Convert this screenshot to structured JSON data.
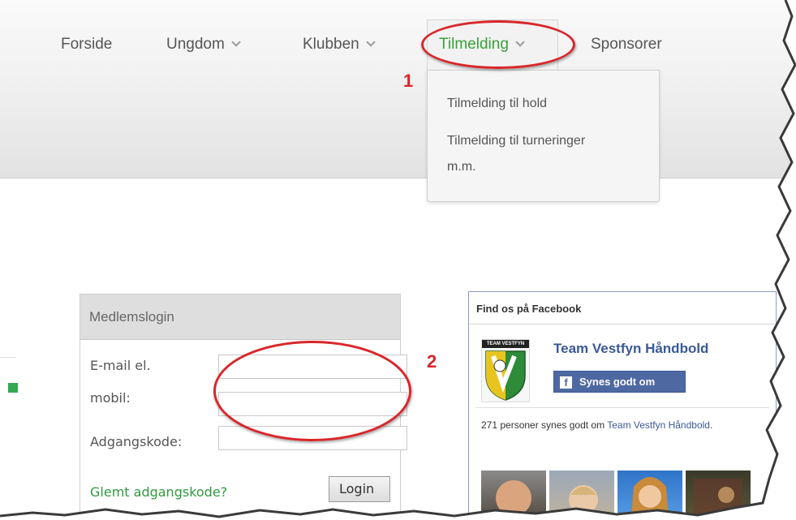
{
  "nav": {
    "items": [
      {
        "label": "Forside",
        "has_chevron": false,
        "active": false
      },
      {
        "label": "Ungdom",
        "has_chevron": true,
        "active": false
      },
      {
        "label": "Klubben",
        "has_chevron": true,
        "active": false
      },
      {
        "label": "Tilmelding",
        "has_chevron": true,
        "active": true
      },
      {
        "label": "Sponsorer",
        "has_chevron": false,
        "active": false
      }
    ],
    "dropdown": {
      "items": [
        {
          "label": "Tilmelding til hold"
        },
        {
          "label": "Tilmelding til turneringer"
        },
        {
          "label": "m.m."
        }
      ]
    }
  },
  "annotations": {
    "marker_1": "1",
    "marker_2": "2",
    "color": "#d9262a"
  },
  "login": {
    "title": "Medlemslogin",
    "email_label_line1": "E-mail el.",
    "email_label_line2": "mobil:",
    "email_value": "",
    "password_label": "Adgangskode:",
    "password_value": "",
    "forgot_link": "Glemt adgangskode?",
    "login_button": "Login"
  },
  "facebook": {
    "title": "Find os på Facebook",
    "logo_text": "TEAM VESTFYN",
    "page_name": "Team Vestfyn Håndbold",
    "like_icon": "f",
    "like_button": "Synes godt om",
    "count_text": "271 personer synes godt om ",
    "count_link": "Team Vestfyn Håndbold",
    "count_suffix": "."
  },
  "colors": {
    "accent_green": "#3aa03a",
    "facebook_blue": "#3b5998",
    "annotation_red": "#d9262a"
  }
}
